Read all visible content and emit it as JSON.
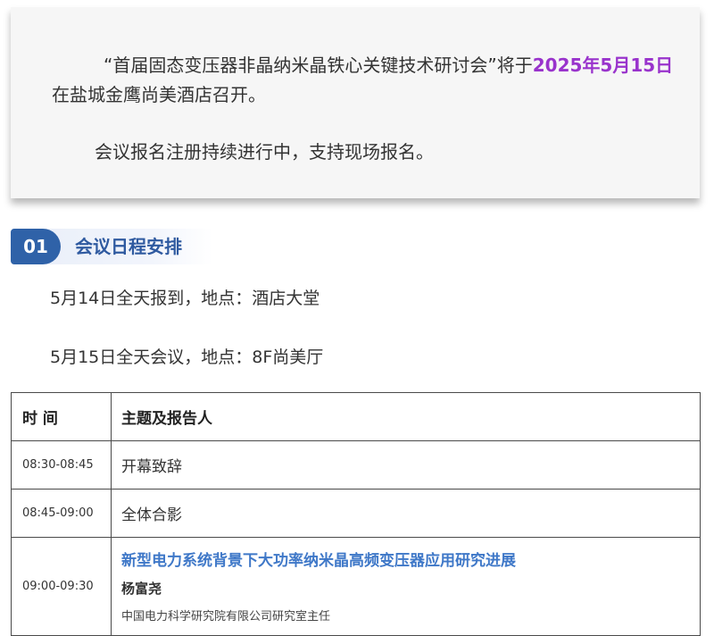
{
  "intro": {
    "p1_text": "“首届固态变压器非晶纳米晶铁心关键技术研讨会”将于",
    "p1_date": "2025年5月15日",
    "p1_rest": "在盐城金鹰尚美酒店召开。",
    "p2_text": "会议报名注册持续进行中，支持现场报名。",
    "highlight_color": "#9933cc"
  },
  "section": {
    "number": "01",
    "title": "会议日程安排",
    "accent_color": "#2f62a8"
  },
  "info": {
    "line1": "5月14日全天报到，地点：酒店大堂",
    "line2": "5月15日全天会议，地点：8F尚美厅"
  },
  "schedule": {
    "headers": {
      "time": "时 间",
      "topic": "主题及报告人"
    },
    "rows": [
      {
        "time": "08:30-08:45",
        "topic": "开幕致辞"
      },
      {
        "time": "08:45-09:00",
        "topic": "全体合影"
      },
      {
        "time": "09:00-09:30",
        "topic": "新型电力系统背景下大功率纳米晶高频变压器应用研究进展",
        "speaker": "杨富尧",
        "affiliation": "中国电力科学研究院有限公司研究室主任"
      }
    ],
    "topic_title_color": "#3f78c8"
  }
}
